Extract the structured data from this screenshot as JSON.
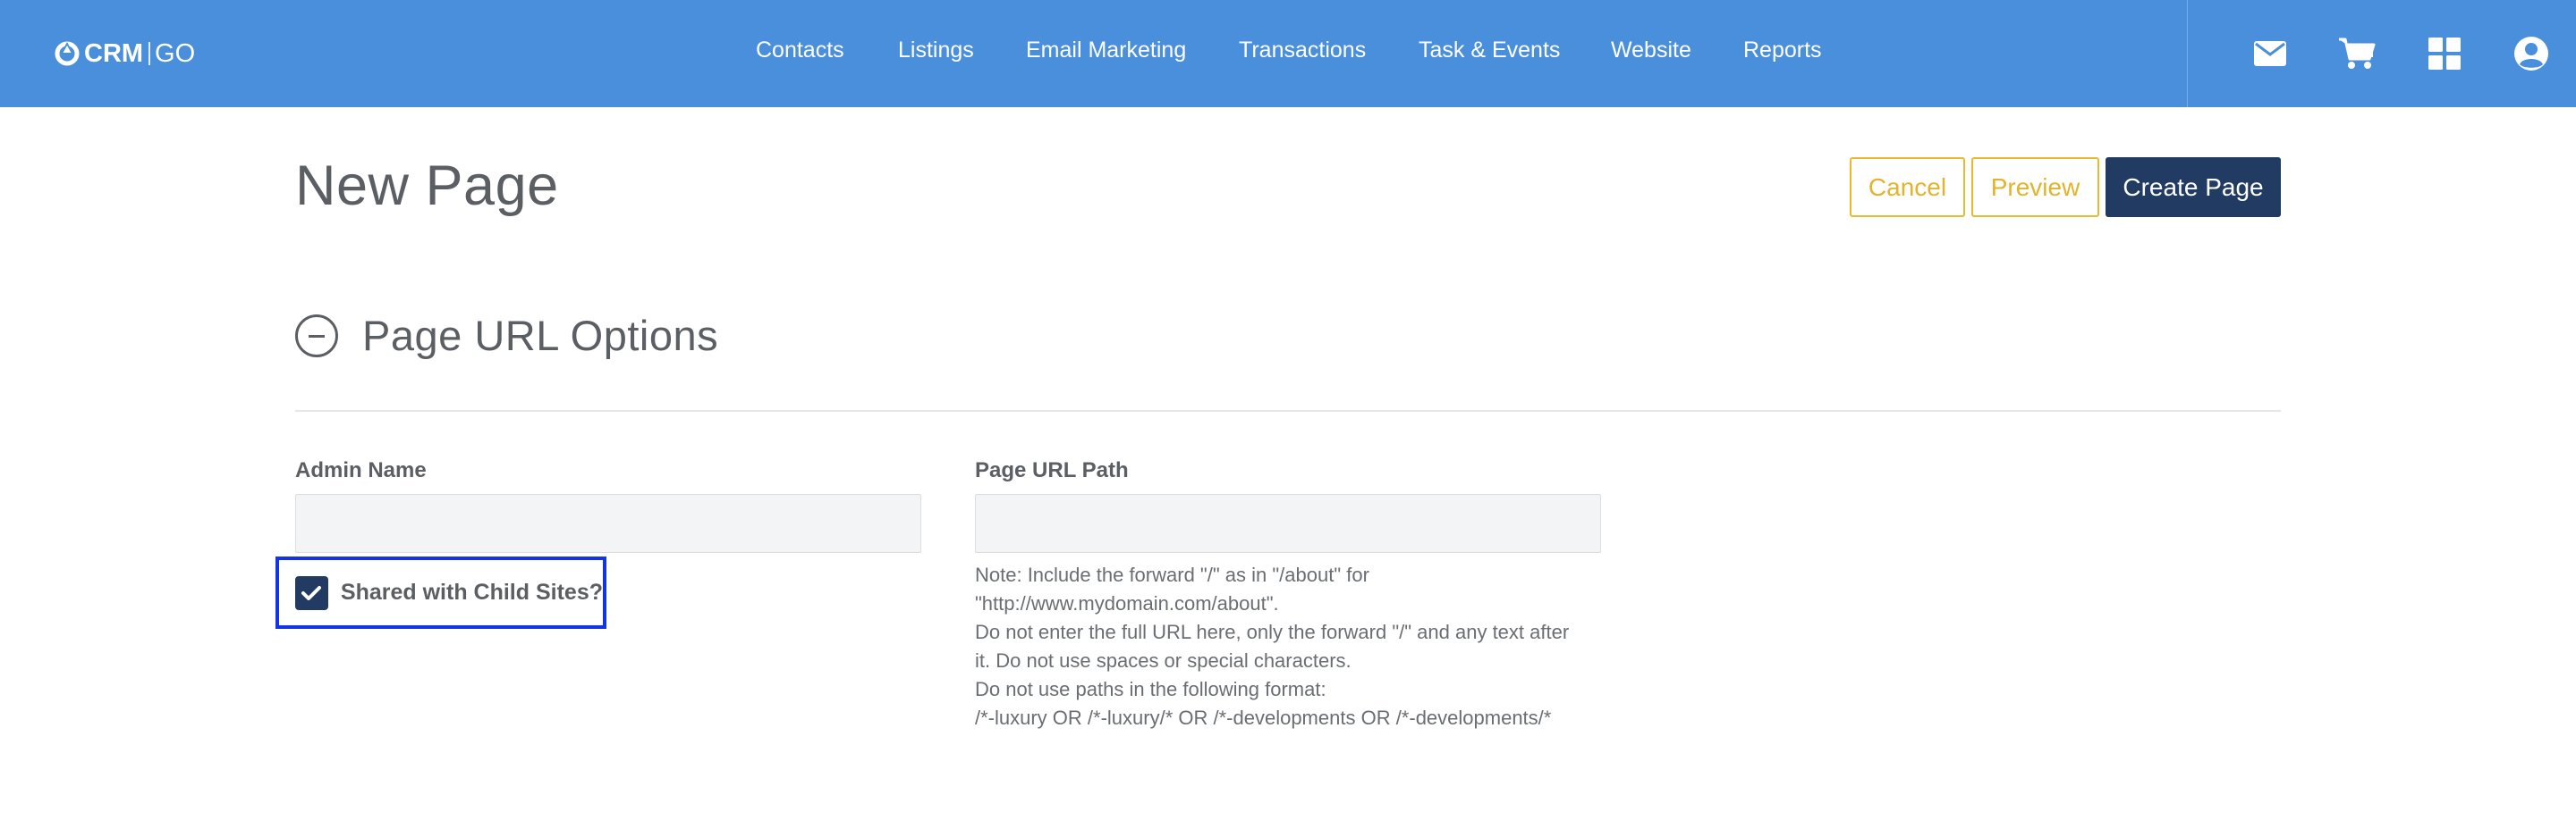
{
  "app": {
    "logo": {
      "crm": "CRM",
      "go": "GO"
    }
  },
  "nav": {
    "items": [
      {
        "label": "Contacts"
      },
      {
        "label": "Listings"
      },
      {
        "label": "Email Marketing"
      },
      {
        "label": "Transactions"
      },
      {
        "label": "Task & Events"
      },
      {
        "label": "Website"
      },
      {
        "label": "Reports"
      }
    ]
  },
  "tools": {
    "icons": [
      "envelope-icon",
      "cart-icon",
      "grid-icon",
      "user-circle-icon"
    ]
  },
  "page": {
    "title": "New Page",
    "buttons": {
      "cancel": "Cancel",
      "preview": "Preview",
      "create": "Create Page"
    }
  },
  "section": {
    "title": "Page URL Options",
    "toggle_icon": "minus-circle-icon"
  },
  "form": {
    "admin_name": {
      "label": "Admin Name",
      "value": "",
      "placeholder": ""
    },
    "page_url_path": {
      "label": "Page URL Path",
      "value": "",
      "placeholder": ""
    },
    "shared_checkbox": {
      "label": "Shared with Child Sites?",
      "checked": true
    },
    "note_lines": [
      "Note: Include the forward \"/\" as in \"/about\" for",
      "\"http://www.mydomain.com/about\".",
      "Do not enter the full URL here, only the forward \"/\" and any text after",
      "it. Do not use spaces or special characters.",
      "Do not use paths in the following format:",
      "/*-luxury OR /*-luxury/* OR /*-developments OR /*-developments/*"
    ]
  },
  "colors": {
    "topbar": "#4a8fdc",
    "primary": "#213b63",
    "accent_outline": "#e8b931",
    "focus_outline": "#1034e6",
    "text": "#5b5f63"
  }
}
